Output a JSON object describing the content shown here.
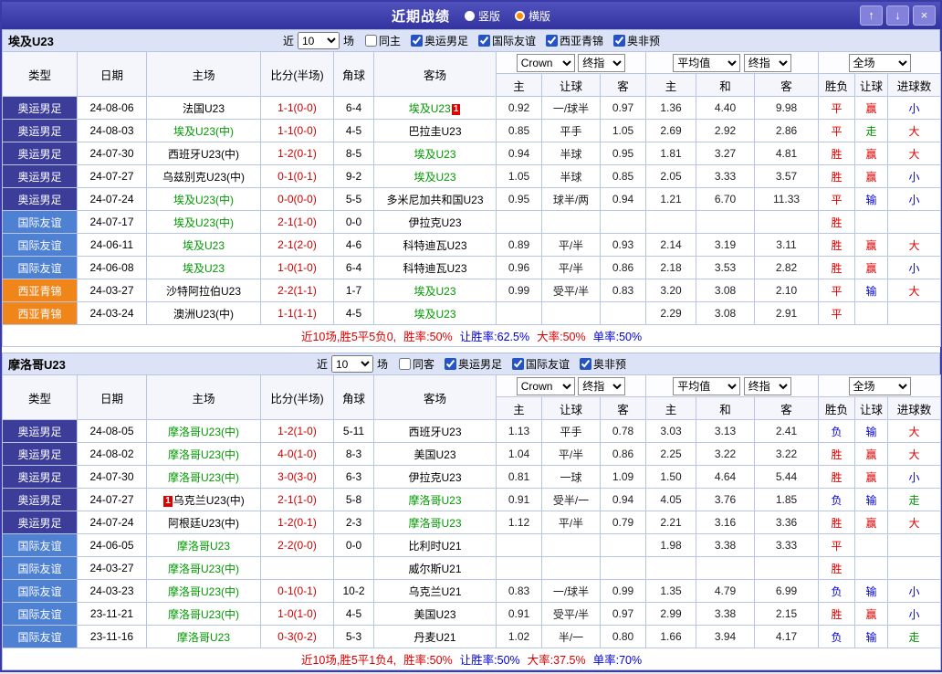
{
  "titlebar": {
    "title": "近期战绩",
    "radio_vertical": "竖版",
    "radio_horizontal": "横版",
    "selected_layout": "横版",
    "buttons": {
      "up": "↑",
      "down": "↓",
      "close": "×"
    }
  },
  "table_header": {
    "main_cols": [
      "类型",
      "日期",
      "主场",
      "比分(半场)",
      "角球",
      "客场"
    ],
    "odds_select1": "Crown",
    "odds_select2": "终指",
    "odds_sub": [
      "主",
      "让球",
      "客"
    ],
    "avg_select1": "平均值",
    "avg_select2": "终指",
    "avg_sub": [
      "主",
      "和",
      "客"
    ],
    "result_select": "全场",
    "result_sub": [
      "胜负",
      "让球",
      "进球数"
    ]
  },
  "sections": [
    {
      "team": "埃及U23",
      "filter": {
        "prefix": "近",
        "games": "10",
        "suffix": "场",
        "same": {
          "label": "同主",
          "checked": false
        },
        "leagues": [
          {
            "label": "奥运男足",
            "checked": true
          },
          {
            "label": "国际友谊",
            "checked": true
          },
          {
            "label": "西亚青锦",
            "checked": true
          },
          {
            "label": "奥非预",
            "checked": true
          }
        ]
      },
      "rows": [
        {
          "type": "奥运男足",
          "type_key": "olympic",
          "date": "24-08-06",
          "home": "法国U23",
          "home_green": false,
          "home_card": "",
          "home_card_pos": "",
          "score": "1-1(0-0)",
          "corner": "6-4",
          "away": "埃及U23",
          "away_green": true,
          "away_card": "1",
          "away_card_pos": "after",
          "odds_home": "0.92",
          "odds_line": "一/球半",
          "odds_away": "0.97",
          "avg_home": "1.36",
          "avg_draw": "4.40",
          "avg_away": "9.98",
          "result": "平",
          "result_color": "red",
          "handicap_result": "赢",
          "handicap_color": "red",
          "goals_result": "小",
          "goals_color": "blue"
        },
        {
          "type": "奥运男足",
          "type_key": "olympic",
          "date": "24-08-03",
          "home": "埃及U23(中)",
          "home_green": true,
          "home_card": "",
          "home_card_pos": "",
          "score": "1-1(0-0)",
          "corner": "4-5",
          "away": "巴拉圭U23",
          "away_green": false,
          "away_card": "",
          "away_card_pos": "",
          "odds_home": "0.85",
          "odds_line": "平手",
          "odds_away": "1.05",
          "avg_home": "2.69",
          "avg_draw": "2.92",
          "avg_away": "2.86",
          "result": "平",
          "result_color": "red",
          "handicap_result": "走",
          "handicap_color": "green",
          "goals_result": "大",
          "goals_color": "red"
        },
        {
          "type": "奥运男足",
          "type_key": "olympic",
          "date": "24-07-30",
          "home": "西班牙U23(中)",
          "home_green": false,
          "home_card": "",
          "home_card_pos": "",
          "score": "1-2(0-1)",
          "corner": "8-5",
          "away": "埃及U23",
          "away_green": true,
          "away_card": "",
          "away_card_pos": "",
          "odds_home": "0.94",
          "odds_line": "半球",
          "odds_away": "0.95",
          "avg_home": "1.81",
          "avg_draw": "3.27",
          "avg_away": "4.81",
          "result": "胜",
          "result_color": "red",
          "handicap_result": "赢",
          "handicap_color": "red",
          "goals_result": "大",
          "goals_color": "red"
        },
        {
          "type": "奥运男足",
          "type_key": "olympic",
          "date": "24-07-27",
          "home": "乌兹别克U23(中)",
          "home_green": false,
          "home_card": "",
          "home_card_pos": "",
          "score": "0-1(0-1)",
          "corner": "9-2",
          "away": "埃及U23",
          "away_green": true,
          "away_card": "",
          "away_card_pos": "",
          "odds_home": "1.05",
          "odds_line": "半球",
          "odds_away": "0.85",
          "avg_home": "2.05",
          "avg_draw": "3.33",
          "avg_away": "3.57",
          "result": "胜",
          "result_color": "red",
          "handicap_result": "赢",
          "handicap_color": "red",
          "goals_result": "小",
          "goals_color": "blue"
        },
        {
          "type": "奥运男足",
          "type_key": "olympic",
          "date": "24-07-24",
          "home": "埃及U23(中)",
          "home_green": true,
          "home_card": "",
          "home_card_pos": "",
          "score": "0-0(0-0)",
          "corner": "5-5",
          "away": "多米尼加共和国U23",
          "away_green": false,
          "away_card": "",
          "away_card_pos": "",
          "odds_home": "0.95",
          "odds_line": "球半/两",
          "odds_away": "0.94",
          "avg_home": "1.21",
          "avg_draw": "6.70",
          "avg_away": "11.33",
          "result": "平",
          "result_color": "red",
          "handicap_result": "输",
          "handicap_color": "blue",
          "goals_result": "小",
          "goals_color": "blue"
        },
        {
          "type": "国际友谊",
          "type_key": "friendly",
          "date": "24-07-17",
          "home": "埃及U23(中)",
          "home_green": true,
          "home_card": "",
          "home_card_pos": "",
          "score": "2-1(1-0)",
          "corner": "0-0",
          "away": "伊拉克U23",
          "away_green": false,
          "away_card": "",
          "away_card_pos": "",
          "odds_home": "",
          "odds_line": "",
          "odds_away": "",
          "avg_home": "",
          "avg_draw": "",
          "avg_away": "",
          "result": "胜",
          "result_color": "red",
          "handicap_result": "",
          "handicap_color": "",
          "goals_result": "",
          "goals_color": ""
        },
        {
          "type": "国际友谊",
          "type_key": "friendly",
          "date": "24-06-11",
          "home": "埃及U23",
          "home_green": true,
          "home_card": "",
          "home_card_pos": "",
          "score": "2-1(2-0)",
          "corner": "4-6",
          "away": "科特迪瓦U23",
          "away_green": false,
          "away_card": "",
          "away_card_pos": "",
          "odds_home": "0.89",
          "odds_line": "平/半",
          "odds_away": "0.93",
          "avg_home": "2.14",
          "avg_draw": "3.19",
          "avg_away": "3.11",
          "result": "胜",
          "result_color": "red",
          "handicap_result": "赢",
          "handicap_color": "red",
          "goals_result": "大",
          "goals_color": "red"
        },
        {
          "type": "国际友谊",
          "type_key": "friendly",
          "date": "24-06-08",
          "home": "埃及U23",
          "home_green": true,
          "home_card": "",
          "home_card_pos": "",
          "score": "1-0(1-0)",
          "corner": "6-4",
          "away": "科特迪瓦U23",
          "away_green": false,
          "away_card": "",
          "away_card_pos": "",
          "odds_home": "0.96",
          "odds_line": "平/半",
          "odds_away": "0.86",
          "avg_home": "2.18",
          "avg_draw": "3.53",
          "avg_away": "2.82",
          "result": "胜",
          "result_color": "red",
          "handicap_result": "赢",
          "handicap_color": "red",
          "goals_result": "小",
          "goals_color": "blue"
        },
        {
          "type": "西亚青锦",
          "type_key": "westasia",
          "date": "24-03-27",
          "home": "沙特阿拉伯U23",
          "home_green": false,
          "home_card": "",
          "home_card_pos": "",
          "score": "2-2(1-1)",
          "corner": "1-7",
          "away": "埃及U23",
          "away_green": true,
          "away_card": "",
          "away_card_pos": "",
          "odds_home": "0.99",
          "odds_line": "受平/半",
          "odds_away": "0.83",
          "avg_home": "3.20",
          "avg_draw": "3.08",
          "avg_away": "2.10",
          "result": "平",
          "result_color": "red",
          "handicap_result": "输",
          "handicap_color": "blue",
          "goals_result": "大",
          "goals_color": "red"
        },
        {
          "type": "西亚青锦",
          "type_key": "westasia",
          "date": "24-03-24",
          "home": "澳洲U23(中)",
          "home_green": false,
          "home_card": "",
          "home_card_pos": "",
          "score": "1-1(1-1)",
          "corner": "4-5",
          "away": "埃及U23",
          "away_green": true,
          "away_card": "",
          "away_card_pos": "",
          "odds_home": "",
          "odds_line": "",
          "odds_away": "",
          "avg_home": "2.29",
          "avg_draw": "3.08",
          "avg_away": "2.91",
          "result": "平",
          "result_color": "red",
          "handicap_result": "",
          "handicap_color": "",
          "goals_result": "",
          "goals_color": ""
        }
      ],
      "footer": [
        {
          "text": "近10场,胜5平5负0,",
          "color": "#dd0000"
        },
        {
          "text": "胜率:50%",
          "color": "#dd0000"
        },
        {
          "text": "让胜率:62.5%",
          "color": "#0000dd"
        },
        {
          "text": "大率:50%",
          "color": "#dd0000"
        },
        {
          "text": "单率:50%",
          "color": "#0000dd"
        }
      ]
    },
    {
      "team": "摩洛哥U23",
      "filter": {
        "prefix": "近",
        "games": "10",
        "suffix": "场",
        "same": {
          "label": "同客",
          "checked": false
        },
        "leagues": [
          {
            "label": "奥运男足",
            "checked": true
          },
          {
            "label": "国际友谊",
            "checked": true
          },
          {
            "label": "奥非预",
            "checked": true
          }
        ]
      },
      "rows": [
        {
          "type": "奥运男足",
          "type_key": "olympic",
          "date": "24-08-05",
          "home": "摩洛哥U23(中)",
          "home_green": true,
          "home_card": "",
          "home_card_pos": "",
          "score": "1-2(1-0)",
          "corner": "5-11",
          "away": "西班牙U23",
          "away_green": false,
          "away_card": "",
          "away_card_pos": "",
          "odds_home": "1.13",
          "odds_line": "平手",
          "odds_away": "0.78",
          "avg_home": "3.03",
          "avg_draw": "3.13",
          "avg_away": "2.41",
          "result": "负",
          "result_color": "blue",
          "handicap_result": "输",
          "handicap_color": "blue",
          "goals_result": "大",
          "goals_color": "red"
        },
        {
          "type": "奥运男足",
          "type_key": "olympic",
          "date": "24-08-02",
          "home": "摩洛哥U23(中)",
          "home_green": true,
          "home_card": "",
          "home_card_pos": "",
          "score": "4-0(1-0)",
          "corner": "8-3",
          "away": "美国U23",
          "away_green": false,
          "away_card": "",
          "away_card_pos": "",
          "odds_home": "1.04",
          "odds_line": "平/半",
          "odds_away": "0.86",
          "avg_home": "2.25",
          "avg_draw": "3.22",
          "avg_away": "3.22",
          "result": "胜",
          "result_color": "red",
          "handicap_result": "赢",
          "handicap_color": "red",
          "goals_result": "大",
          "goals_color": "red"
        },
        {
          "type": "奥运男足",
          "type_key": "olympic",
          "date": "24-07-30",
          "home": "摩洛哥U23(中)",
          "home_green": true,
          "home_card": "",
          "home_card_pos": "",
          "score": "3-0(3-0)",
          "corner": "6-3",
          "away": "伊拉克U23",
          "away_green": false,
          "away_card": "",
          "away_card_pos": "",
          "odds_home": "0.81",
          "odds_line": "一球",
          "odds_away": "1.09",
          "avg_home": "1.50",
          "avg_draw": "4.64",
          "avg_away": "5.44",
          "result": "胜",
          "result_color": "red",
          "handicap_result": "赢",
          "handicap_color": "red",
          "goals_result": "小",
          "goals_color": "blue"
        },
        {
          "type": "奥运男足",
          "type_key": "olympic",
          "date": "24-07-27",
          "home": "乌克兰U23(中)",
          "home_green": false,
          "home_card": "1",
          "home_card_pos": "before",
          "score": "2-1(1-0)",
          "corner": "5-8",
          "away": "摩洛哥U23",
          "away_green": true,
          "away_card": "",
          "away_card_pos": "",
          "odds_home": "0.91",
          "odds_line": "受半/一",
          "odds_away": "0.94",
          "avg_home": "4.05",
          "avg_draw": "3.76",
          "avg_away": "1.85",
          "result": "负",
          "result_color": "blue",
          "handicap_result": "输",
          "handicap_color": "blue",
          "goals_result": "走",
          "goals_color": "green"
        },
        {
          "type": "奥运男足",
          "type_key": "olympic",
          "date": "24-07-24",
          "home": "阿根廷U23(中)",
          "home_green": false,
          "home_card": "",
          "home_card_pos": "",
          "score": "1-2(0-1)",
          "corner": "2-3",
          "away": "摩洛哥U23",
          "away_green": true,
          "away_card": "",
          "away_card_pos": "",
          "odds_home": "1.12",
          "odds_line": "平/半",
          "odds_away": "0.79",
          "avg_home": "2.21",
          "avg_draw": "3.16",
          "avg_away": "3.36",
          "result": "胜",
          "result_color": "red",
          "handicap_result": "赢",
          "handicap_color": "red",
          "goals_result": "大",
          "goals_color": "red"
        },
        {
          "type": "国际友谊",
          "type_key": "friendly",
          "date": "24-06-05",
          "home": "摩洛哥U23",
          "home_green": true,
          "home_card": "",
          "home_card_pos": "",
          "score": "2-2(0-0)",
          "corner": "0-0",
          "away": "比利时U21",
          "away_green": false,
          "away_card": "",
          "away_card_pos": "",
          "odds_home": "",
          "odds_line": "",
          "odds_away": "",
          "avg_home": "1.98",
          "avg_draw": "3.38",
          "avg_away": "3.33",
          "result": "平",
          "result_color": "red",
          "handicap_result": "",
          "handicap_color": "",
          "goals_result": "",
          "goals_color": ""
        },
        {
          "type": "国际友谊",
          "type_key": "friendly",
          "date": "24-03-27",
          "home": "摩洛哥U23(中)",
          "home_green": true,
          "home_card": "",
          "home_card_pos": "",
          "score": "",
          "corner": "",
          "away": "威尔斯U21",
          "away_green": false,
          "away_card": "",
          "away_card_pos": "",
          "odds_home": "",
          "odds_line": "",
          "odds_away": "",
          "avg_home": "",
          "avg_draw": "",
          "avg_away": "",
          "result": "胜",
          "result_color": "red",
          "handicap_result": "",
          "handicap_color": "",
          "goals_result": "",
          "goals_color": ""
        },
        {
          "type": "国际友谊",
          "type_key": "friendly",
          "date": "24-03-23",
          "home": "摩洛哥U23(中)",
          "home_green": true,
          "home_card": "",
          "home_card_pos": "",
          "score": "0-1(0-1)",
          "corner": "10-2",
          "away": "乌克兰U21",
          "away_green": false,
          "away_card": "",
          "away_card_pos": "",
          "odds_home": "0.83",
          "odds_line": "一/球半",
          "odds_away": "0.99",
          "avg_home": "1.35",
          "avg_draw": "4.79",
          "avg_away": "6.99",
          "result": "负",
          "result_color": "blue",
          "handicap_result": "输",
          "handicap_color": "blue",
          "goals_result": "小",
          "goals_color": "blue"
        },
        {
          "type": "国际友谊",
          "type_key": "friendly",
          "date": "23-11-21",
          "home": "摩洛哥U23(中)",
          "home_green": true,
          "home_card": "",
          "home_card_pos": "",
          "score": "1-0(1-0)",
          "corner": "4-5",
          "away": "美国U23",
          "away_green": false,
          "away_card": "",
          "away_card_pos": "",
          "odds_home": "0.91",
          "odds_line": "受平/半",
          "odds_away": "0.97",
          "avg_home": "2.99",
          "avg_draw": "3.38",
          "avg_away": "2.15",
          "result": "胜",
          "result_color": "red",
          "handicap_result": "赢",
          "handicap_color": "red",
          "goals_result": "小",
          "goals_color": "blue"
        },
        {
          "type": "国际友谊",
          "type_key": "friendly",
          "date": "23-11-16",
          "home": "摩洛哥U23",
          "home_green": true,
          "home_card": "",
          "home_card_pos": "",
          "score": "0-3(0-2)",
          "corner": "5-3",
          "away": "丹麦U21",
          "away_green": false,
          "away_card": "",
          "away_card_pos": "",
          "odds_home": "1.02",
          "odds_line": "半/一",
          "odds_away": "0.80",
          "avg_home": "1.66",
          "avg_draw": "3.94",
          "avg_away": "4.17",
          "result": "负",
          "result_color": "blue",
          "handicap_result": "输",
          "handicap_color": "blue",
          "goals_result": "走",
          "goals_color": "green"
        }
      ],
      "footer": [
        {
          "text": "近10场,胜5平1负4,",
          "color": "#dd0000"
        },
        {
          "text": "胜率:50%",
          "color": "#dd0000"
        },
        {
          "text": "让胜率:50%",
          "color": "#0000dd"
        },
        {
          "text": "大率:37.5%",
          "color": "#dd0000"
        },
        {
          "text": "单率:70%",
          "color": "#0000dd"
        }
      ]
    }
  ]
}
